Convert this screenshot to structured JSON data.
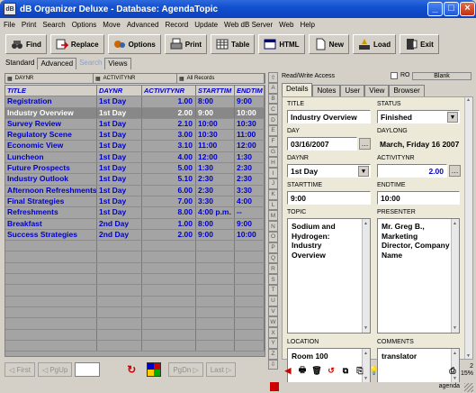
{
  "window": {
    "title": "dB Organizer Deluxe - Database: AgendaTopic",
    "icon_text": "dB"
  },
  "menu": [
    "File",
    "Print",
    "Search",
    "Options",
    "Move",
    "Advanced",
    "Record",
    "Update",
    "Web dB Server",
    "Web",
    "Help"
  ],
  "toolbar": {
    "find": "Find",
    "replace": "Replace",
    "options": "Options",
    "print": "Print",
    "table": "Table",
    "html": "HTML",
    "new": "New",
    "load": "Load",
    "exit": "Exit"
  },
  "view_tabs": [
    "Standard",
    "Advanced",
    "Search",
    "Views"
  ],
  "grid_sort": {
    "col1": "DAYNR",
    "col2": "ACTIVITYNR",
    "col3": "All Records"
  },
  "grid": {
    "columns": [
      "TITLE",
      "DAYNR",
      "ACTIVITYNR",
      "STARTTIM",
      "ENDTIM"
    ],
    "rows": [
      [
        "Registration",
        "1st Day",
        "1.00",
        "8:00",
        "9:00"
      ],
      [
        "Industry Overview",
        "1st Day",
        "2.00",
        "9:00",
        "10:00"
      ],
      [
        "Survey Review",
        "1st Day",
        "2.10",
        "10:00",
        "10:30"
      ],
      [
        "Regulatory Scene",
        "1st Day",
        "3.00",
        "10:30",
        "11:00"
      ],
      [
        "Economic View",
        "1st Day",
        "3.10",
        "11:00",
        "12:00"
      ],
      [
        "Luncheon",
        "1st Day",
        "4.00",
        "12:00",
        "1:30"
      ],
      [
        "Future Prospects",
        "1st Day",
        "5.00",
        "1:30",
        "2:30"
      ],
      [
        "Industry Outlook",
        "1st Day",
        "5.10",
        "2:30",
        "2:30"
      ],
      [
        "Afternoon Refreshments",
        "1st Day",
        "6.00",
        "2:30",
        "3:30"
      ],
      [
        "Final Strategies",
        "1st Day",
        "7.00",
        "3:30",
        "4:00"
      ],
      [
        "Refreshments",
        "1st Day",
        "8.00",
        "4:00 p.m.",
        "--"
      ],
      [
        "Breakfast",
        "2nd Day",
        "1.00",
        "8:00",
        "9:00"
      ],
      [
        "Success Strategies",
        "2nd Day",
        "2.00",
        "9:00",
        "10:00"
      ]
    ],
    "selected_index": 1
  },
  "nav": {
    "first": "First",
    "pgup": "PgUp",
    "pgdn": "PgDn",
    "last": "Last"
  },
  "letters": [
    "A",
    "B",
    "C",
    "D",
    "E",
    "F",
    "G",
    "H",
    "I",
    "J",
    "K",
    "L",
    "M",
    "N",
    "O",
    "P",
    "Q",
    "R",
    "S",
    "T",
    "U",
    "V",
    "W",
    "X",
    "Y",
    "Z"
  ],
  "access": {
    "label": "Read/Write Access",
    "ro": "RO",
    "blank": "Blank"
  },
  "detail_tabs": [
    "Details",
    "Notes",
    "User",
    "View",
    "Browser"
  ],
  "detail": {
    "title_label": "TITLE",
    "title": "Industry Overview",
    "status_label": "STATUS",
    "status": "Finished",
    "day_label": "DAY",
    "day": "03/16/2007",
    "daylong_label": "DAYLONG",
    "daylong": "March, Friday 16 2007",
    "daynr_label": "DAYNR",
    "daynr": "1st Day",
    "activitynr_label": "ACTIVITYNR",
    "activitynr": "2.00",
    "starttime_label": "STARTTIME",
    "starttime": "9:00",
    "endtime_label": "ENDTIME",
    "endtime": "10:00",
    "topic_label": "TOPIC",
    "topic": "Sodium and Hydrogen: Industry Overview",
    "presenter_label": "PRESENTER",
    "presenter": "Mr. Greg B., Marketing Director, Company Name",
    "location_label": "LOCATION",
    "location": "Room 100",
    "comments_label": "COMMENTS",
    "comments": "translator"
  },
  "statusbar": {
    "count": "2",
    "zoom": "15%",
    "db": "agenda"
  }
}
